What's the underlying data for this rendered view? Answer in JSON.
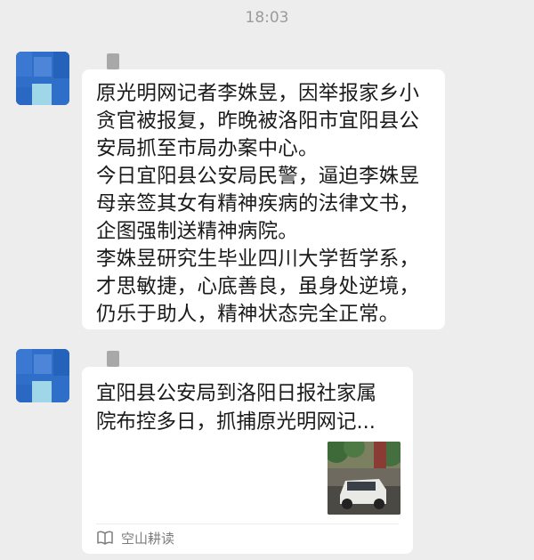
{
  "chat": {
    "timestamp": "18:03",
    "messages": [
      {
        "type": "text",
        "paragraphs": [
          "原光明网记者李姝昱，因举报家乡小贪官被报复，昨晚被洛阳市宜阳县公安局抓至市局办案中心。",
          "今日宜阳县公安局民警，逼迫李姝昱母亲签其女有精神疾病的法律文书，企图强制送精神病院。",
          "李姝昱研究生毕业四川大学哲学系，才思敏捷，心底善良，虽身处逆境，仍乐于助人，精神状态完全正常。"
        ]
      },
      {
        "type": "link-card",
        "title": "宜阳县公安局到洛阳日报社家属院布控多日，抓捕原光明网记...",
        "source": "空山耕读",
        "source_icon": "book-open-icon",
        "thumbnail": "street-photo-white-car"
      }
    ]
  },
  "colors": {
    "background": "#ededed",
    "bubble": "#ffffff",
    "avatar": "#2e6cc7"
  }
}
